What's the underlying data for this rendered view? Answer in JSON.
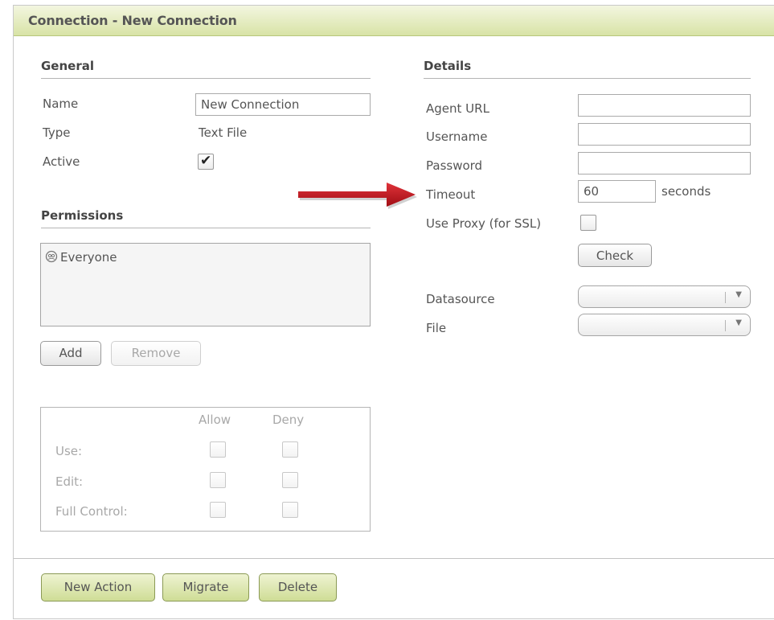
{
  "window": {
    "title": "Connection - New Connection"
  },
  "general": {
    "header": "General",
    "name_label": "Name",
    "name_value": "New Connection",
    "type_label": "Type",
    "type_value": "Text File",
    "active_label": "Active",
    "active_checked": true
  },
  "permissions": {
    "header": "Permissions",
    "entries": [
      "Everyone"
    ],
    "add_label": "Add",
    "remove_label": "Remove",
    "matrix": {
      "columns": [
        "Allow",
        "Deny"
      ],
      "rows": [
        "Use:",
        "Edit:",
        "Full Control:"
      ]
    }
  },
  "details": {
    "header": "Details",
    "agent_url_label": "Agent URL",
    "agent_url_value": "",
    "username_label": "Username",
    "username_value": "",
    "password_label": "Password",
    "password_value": "",
    "timeout_label": "Timeout",
    "timeout_value": "60",
    "timeout_unit": "seconds",
    "use_proxy_label": "Use Proxy (for SSL)",
    "use_proxy_checked": false,
    "check_label": "Check",
    "datasource_label": "Datasource",
    "datasource_value": "",
    "file_label": "File",
    "file_value": ""
  },
  "footer": {
    "new_action_label": "New Action",
    "migrate_label": "Migrate",
    "delete_label": "Delete"
  },
  "annotation": {
    "arrow_color": "#c0141b"
  },
  "theme": {
    "accent": "#d8e3a6",
    "accent_border": "#8b9a55"
  }
}
